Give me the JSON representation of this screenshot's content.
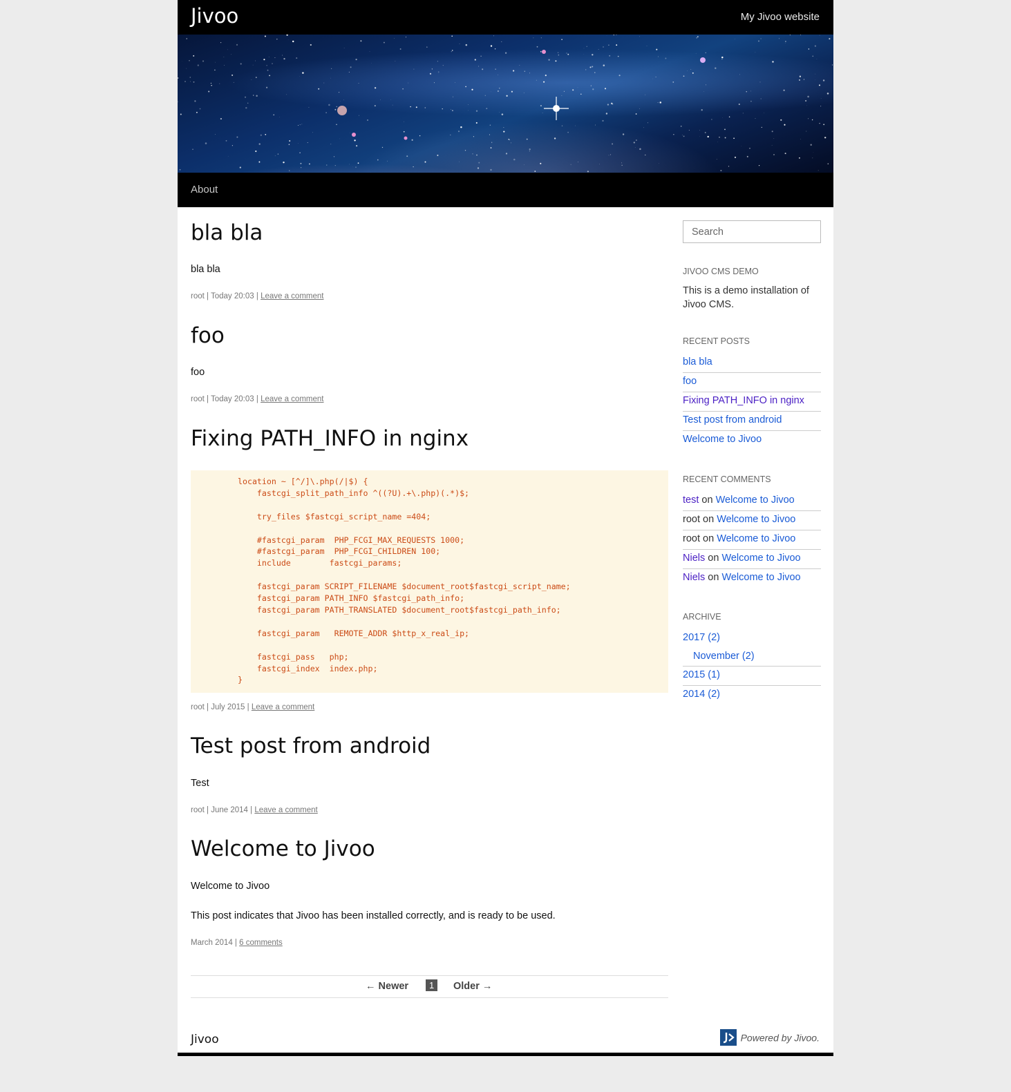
{
  "header": {
    "site_title": "Jivoo",
    "site_subtitle": "My Jivoo website"
  },
  "nav": {
    "items": [
      "About"
    ]
  },
  "posts": [
    {
      "title": "bla bla",
      "body": [
        "bla bla"
      ],
      "author": "root",
      "date": "Today 20:03",
      "comment_link": "Leave a comment"
    },
    {
      "title": "foo",
      "body": [
        "foo"
      ],
      "author": "root",
      "date": "Today 20:03",
      "comment_link": "Leave a comment"
    },
    {
      "title": "Fixing PATH_INFO in nginx",
      "code": "location ~ [^/]\\.php(/|$) {\n    fastcgi_split_path_info ^((?U).+\\.php)(.*)$;\n\n    try_files $fastcgi_script_name =404;\n\n    #fastcgi_param  PHP_FCGI_MAX_REQUESTS 1000;\n    #fastcgi_param  PHP_FCGI_CHILDREN 100;\n    include        fastcgi_params;\n\n    fastcgi_param SCRIPT_FILENAME $document_root$fastcgi_script_name;\n    fastcgi_param PATH_INFO $fastcgi_path_info;\n    fastcgi_param PATH_TRANSLATED $document_root$fastcgi_path_info;\n\n    fastcgi_param   REMOTE_ADDR $http_x_real_ip;\n\n    fastcgi_pass   php;\n    fastcgi_index  index.php;\n}",
      "author": "root",
      "date": "July 2015",
      "comment_link": "Leave a comment"
    },
    {
      "title": "Test post from android",
      "body": [
        "Test"
      ],
      "author": "root",
      "date": "June 2014",
      "comment_link": "Leave a comment"
    },
    {
      "title": "Welcome to Jivoo",
      "body": [
        "Welcome to Jivoo",
        "This post indicates that Jivoo has been installed correctly, and is ready to be used."
      ],
      "date": "March 2014",
      "comment_link": "6 comments"
    }
  ],
  "pagination": {
    "newer": "← Newer",
    "current": "1",
    "older": "Older →"
  },
  "sidebar": {
    "search_placeholder": "Search",
    "demo": {
      "title": "Jivoo CMS demo",
      "text": "This is a demo installation of Jivoo CMS."
    },
    "recent_posts": {
      "title": "Recent posts",
      "items": [
        "bla bla",
        "foo",
        "Fixing PATH_INFO in nginx",
        "Test post from android",
        "Welcome to Jivoo"
      ]
    },
    "recent_comments": {
      "title": "Recent comments",
      "connector": "on",
      "items": [
        {
          "author": "test",
          "post": "Welcome to Jivoo"
        },
        {
          "author": "root",
          "post": "Welcome to Jivoo"
        },
        {
          "author": "root",
          "post": "Welcome to Jivoo"
        },
        {
          "author": "Niels",
          "post": "Welcome to Jivoo"
        },
        {
          "author": "Niels",
          "post": "Welcome to Jivoo"
        }
      ]
    },
    "archive": {
      "title": "Archive",
      "items": [
        "2017 (2)",
        "November (2)",
        "2015 (1)",
        "2014 (2)"
      ]
    }
  },
  "footer": {
    "title": "Jivoo",
    "powered": "Powered by Jivoo."
  },
  "colors": {
    "link": "#1a5bd6",
    "visited_link": "#4a1fc4",
    "code_bg": "#fdf6e3",
    "code_text": "#cb4b16"
  }
}
